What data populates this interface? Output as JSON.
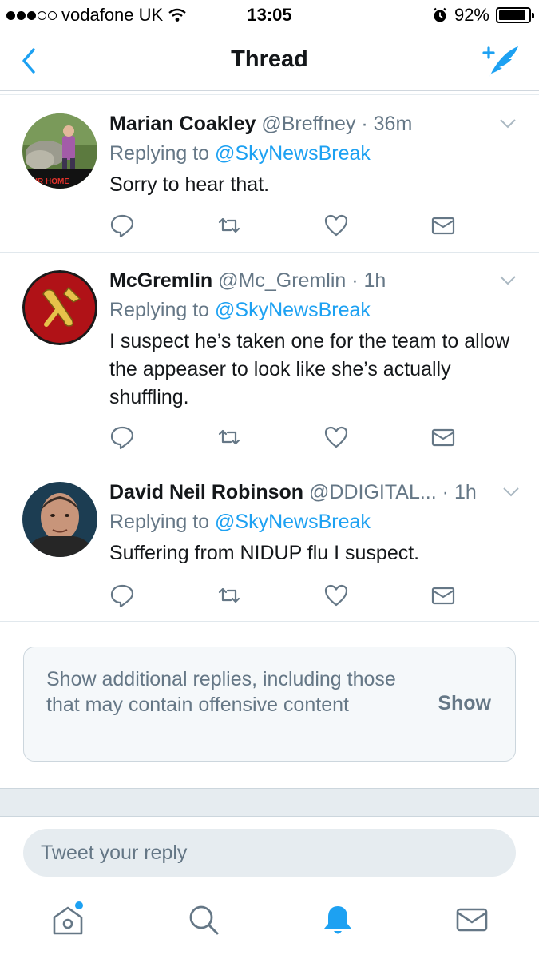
{
  "status_bar": {
    "carrier": "vodafone UK",
    "time": "13:05",
    "battery": "92%",
    "battery_level": 0.92
  },
  "nav": {
    "title": "Thread",
    "back_icon": "chevron-left-icon",
    "compose_icon": "compose-tweet-icon"
  },
  "tweets": [
    {
      "name": "Marian Coakley",
      "handle": "@Breffney",
      "separator": "·",
      "time": "36m",
      "replying_prefix": "Replying to ",
      "replying_to": "@SkyNewsBreak",
      "text": "Sorry to hear that."
    },
    {
      "name": "McGremlin",
      "handle": "@Mc_Gremlin",
      "separator": "·",
      "time": "1h",
      "replying_prefix": "Replying to ",
      "replying_to": "@SkyNewsBreak",
      "text": "I suspect he’s taken one for the team to allow the appeaser to look like she’s actually shuffling."
    },
    {
      "name": "David Neil Robinson",
      "handle": "@DDIGITAL...",
      "separator": "·",
      "time": "1h",
      "replying_prefix": "Replying to ",
      "replying_to": "@SkyNewsBreak",
      "text": "Suffering from NIDUP flu I suspect."
    }
  ],
  "avatar_logo_text": "OUR HOME",
  "show_more": {
    "text": "Show additional replies, including those that may contain offensive content",
    "button": "Show"
  },
  "reply": {
    "placeholder": "Tweet your reply"
  },
  "tab_bar": {
    "items": [
      "home-icon",
      "search-icon",
      "notifications-icon",
      "messages-icon"
    ],
    "active": "notifications-icon"
  },
  "colors": {
    "accent": "#1da1f2",
    "secondary_text": "#657786",
    "divider": "#e1e8ed"
  }
}
